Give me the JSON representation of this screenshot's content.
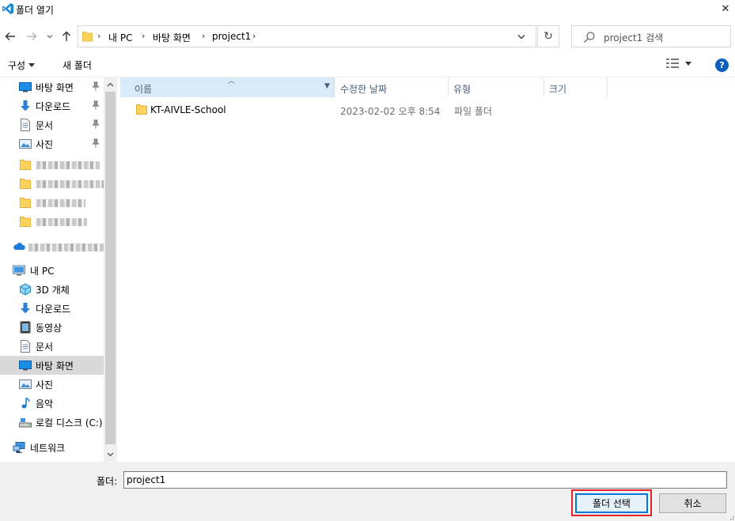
{
  "window": {
    "title": "폴더 열기",
    "close_glyph": "✕"
  },
  "address": {
    "crumbs": [
      "내 PC",
      "바탕 화면",
      "project1"
    ],
    "refresh_glyph": "↻"
  },
  "search": {
    "placeholder": "project1 검색"
  },
  "toolbar": {
    "organize_label": "구성",
    "new_folder_label": "새 폴더",
    "help_label": "?"
  },
  "nav": {
    "quick_access": [
      {
        "label": "바탕 화면",
        "icon": "desktop-icon",
        "pinned": true
      },
      {
        "label": "다운로드",
        "icon": "download-arrow-icon",
        "pinned": true
      },
      {
        "label": "문서",
        "icon": "document-icon",
        "pinned": true
      },
      {
        "label": "사진",
        "icon": "picture-icon",
        "pinned": true
      }
    ],
    "this_pc_label": "내 PC",
    "this_pc_items": [
      {
        "label": "3D 개체",
        "icon": "3d-objects-icon"
      },
      {
        "label": "다운로드",
        "icon": "download-arrow-icon"
      },
      {
        "label": "동영상",
        "icon": "video-icon"
      },
      {
        "label": "문서",
        "icon": "document-icon"
      },
      {
        "label": "바탕 화면",
        "icon": "desktop-icon",
        "selected": true
      },
      {
        "label": "사진",
        "icon": "picture-icon"
      },
      {
        "label": "음악",
        "icon": "music-note-icon"
      },
      {
        "label": "로컬 디스크 (C:)",
        "icon": "local-disk-icon"
      }
    ],
    "network_label": "네트워크"
  },
  "list": {
    "columns": [
      "이름",
      "수정한 날짜",
      "유형",
      "크기"
    ],
    "rows": [
      {
        "name": "KT-AIVLE-School",
        "date": "2023-02-02 오후 8:54",
        "type": "파일 폴더",
        "size": ""
      }
    ]
  },
  "footer": {
    "folder_label": "폴더:",
    "folder_value": "project1",
    "select_label": "폴더 선택",
    "cancel_label": "취소"
  },
  "colors": {
    "accent": "#0078d7",
    "selection_bg": "#d9ebf9",
    "highlight_border": "#e0242b",
    "folder_yellow": "#ffd35b"
  }
}
